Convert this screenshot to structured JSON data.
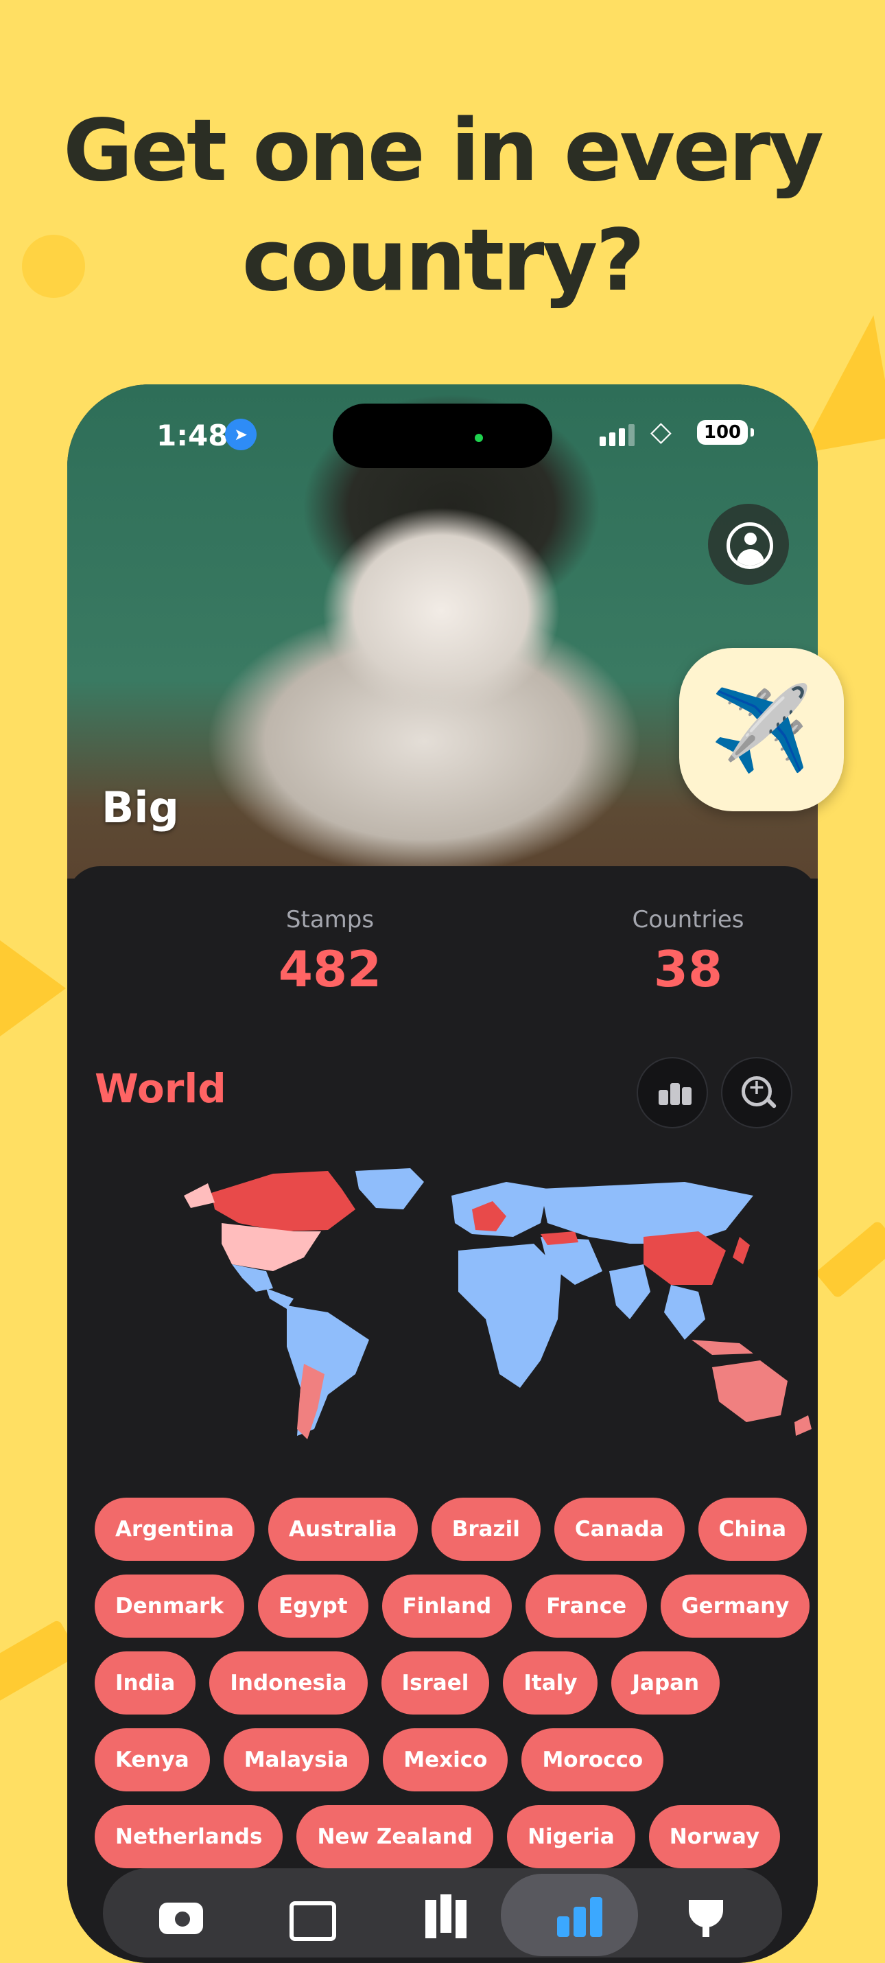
{
  "headline": {
    "line1": "Get one in every",
    "line2": "country?"
  },
  "status_bar": {
    "time": "1:48",
    "battery": "100"
  },
  "profile": {
    "pet_name": "Big"
  },
  "stats": {
    "stamps_label": "Stamps",
    "stamps_value": "482",
    "countries_label": "Countries",
    "countries_value": "38"
  },
  "map_section": {
    "title": "World"
  },
  "countries": [
    "Argentina",
    "Australia",
    "Brazil",
    "Canada",
    "China",
    "Denmark",
    "Egypt",
    "Finland",
    "France",
    "Germany",
    "India",
    "Indonesia",
    "Israel",
    "Italy",
    "Japan",
    "Kenya",
    "Malaysia",
    "Mexico",
    "Morocco",
    "Netherlands",
    "New Zealand",
    "Nigeria",
    "Norway"
  ],
  "colors": {
    "background": "#FFDF63",
    "accent": "#FF6464",
    "chip": "#F26A6A",
    "visited_map": "#E84A4A",
    "unvisited_map": "#8FBDFB",
    "active_tab": "#3BA8FF"
  },
  "icons": {
    "travel_button": "airplane-icon",
    "tabs": [
      "camera-icon",
      "photos-icon",
      "map-icon",
      "stats-icon",
      "trophy-icon"
    ]
  }
}
